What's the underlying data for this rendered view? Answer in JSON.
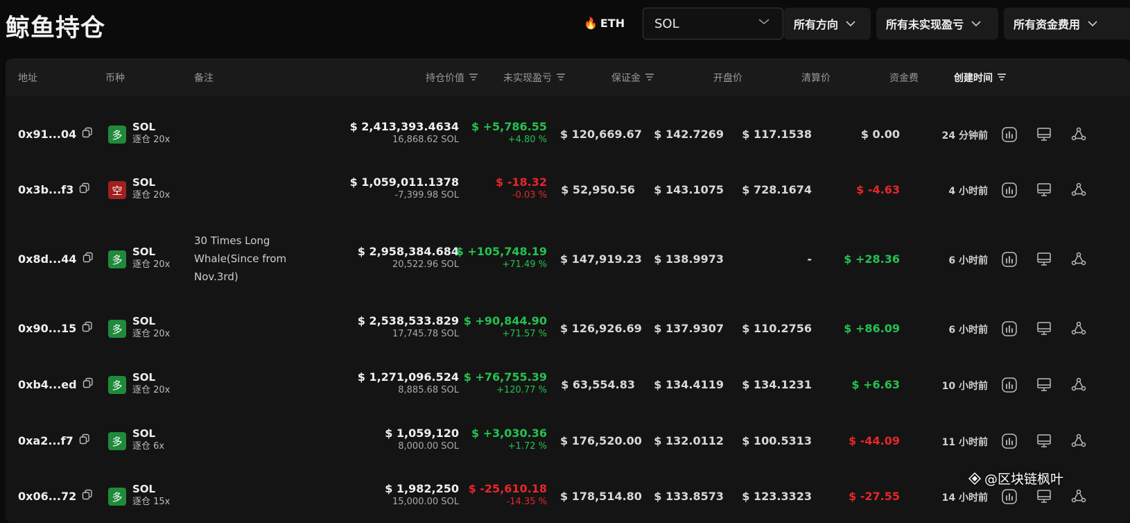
{
  "header": {
    "title": "鲸鱼持仓",
    "eth_tab": "ETH",
    "coin_select": "SOL",
    "filter_direction": "所有方向",
    "filter_pnl": "所有未实现盈亏",
    "filter_funding": "所有资金费用"
  },
  "columns": {
    "address": "地址",
    "coin": "币种",
    "note": "备注",
    "position_value": "持仓价值",
    "unrealized_pnl": "未实现盈亏",
    "margin": "保证金",
    "entry_price": "开盘价",
    "liq_price": "清算价",
    "funding": "资金费",
    "created": "创建时间"
  },
  "rows": [
    {
      "address": "0x91...04",
      "side": "long",
      "side_label": "多",
      "coin": "SOL",
      "leverage": "逐仓 20x",
      "note": "",
      "value": "$ 2,413,393.4634",
      "qty": "16,868.62 SOL",
      "pnl": "$ +5,786.55",
      "pnl_pct": "+4.80 %",
      "pnl_sign": "pos",
      "margin": "$ 120,669.67",
      "entry": "$ 142.7269",
      "liq": "$ 117.1538",
      "funding": "$ 0.00",
      "funding_sign": "zero",
      "time": "24 分钟前"
    },
    {
      "address": "0x3b...f3",
      "side": "short",
      "side_label": "空",
      "coin": "SOL",
      "leverage": "逐仓 20x",
      "note": "",
      "value": "$ 1,059,011.1378",
      "qty": "-7,399.98 SOL",
      "pnl": "$ -18.32",
      "pnl_pct": "-0.03 %",
      "pnl_sign": "neg",
      "margin": "$ 52,950.56",
      "entry": "$ 143.1075",
      "liq": "$ 728.1674",
      "funding": "$ -4.63",
      "funding_sign": "neg",
      "time": "4 小时前"
    },
    {
      "address": "0x8d...44",
      "side": "long",
      "side_label": "多",
      "coin": "SOL",
      "leverage": "逐仓 20x",
      "note": "30 Times Long Whale(Since from Nov.3rd)",
      "value": "$ 2,958,384.684",
      "qty": "20,522.96 SOL",
      "pnl": "$ +105,748.19",
      "pnl_pct": "+71.49 %",
      "pnl_sign": "pos",
      "margin": "$ 147,919.23",
      "entry": "$ 138.9973",
      "liq": "-",
      "funding": "$ +28.36",
      "funding_sign": "pos",
      "time": "6 小时前"
    },
    {
      "address": "0x90...15",
      "side": "long",
      "side_label": "多",
      "coin": "SOL",
      "leverage": "逐仓 20x",
      "note": "",
      "value": "$ 2,538,533.829",
      "qty": "17,745.78 SOL",
      "pnl": "$ +90,844.90",
      "pnl_pct": "+71.57 %",
      "pnl_sign": "pos",
      "margin": "$ 126,926.69",
      "entry": "$ 137.9307",
      "liq": "$ 110.2756",
      "funding": "$ +86.09",
      "funding_sign": "pos",
      "time": "6 小时前"
    },
    {
      "address": "0xb4...ed",
      "side": "long",
      "side_label": "多",
      "coin": "SOL",
      "leverage": "逐仓 20x",
      "note": "",
      "value": "$ 1,271,096.524",
      "qty": "8,885.68 SOL",
      "pnl": "$ +76,755.39",
      "pnl_pct": "+120.77 %",
      "pnl_sign": "pos",
      "margin": "$ 63,554.83",
      "entry": "$ 134.4119",
      "liq": "$ 134.1231",
      "funding": "$ +6.63",
      "funding_sign": "pos",
      "time": "10 小时前"
    },
    {
      "address": "0xa2...f7",
      "side": "long",
      "side_label": "多",
      "coin": "SOL",
      "leverage": "逐仓 6x",
      "note": "",
      "value": "$ 1,059,120",
      "qty": "8,000.00 SOL",
      "pnl": "$ +3,030.36",
      "pnl_pct": "+1.72 %",
      "pnl_sign": "pos",
      "margin": "$ 176,520.00",
      "entry": "$ 132.0112",
      "liq": "$ 100.5313",
      "funding": "$ -44.09",
      "funding_sign": "neg",
      "time": "11 小时前"
    },
    {
      "address": "0x06...72",
      "side": "long",
      "side_label": "多",
      "coin": "SOL",
      "leverage": "逐仓 15x",
      "note": "",
      "value": "$ 1,982,250",
      "qty": "15,000.00 SOL",
      "pnl": "$ -25,610.18",
      "pnl_pct": "-14.35 %",
      "pnl_sign": "neg",
      "margin": "$ 178,514.80",
      "entry": "$ 133.8573",
      "liq": "$ 123.3323",
      "funding": "$ -27.55",
      "funding_sign": "neg",
      "time": "14 小时前"
    }
  ],
  "watermark": "@区块链枫叶",
  "colors": {
    "positive": "#24c24f",
    "negative": "#e8262a",
    "long_badge": "#1f8a3a",
    "short_badge": "#a11f1f"
  }
}
